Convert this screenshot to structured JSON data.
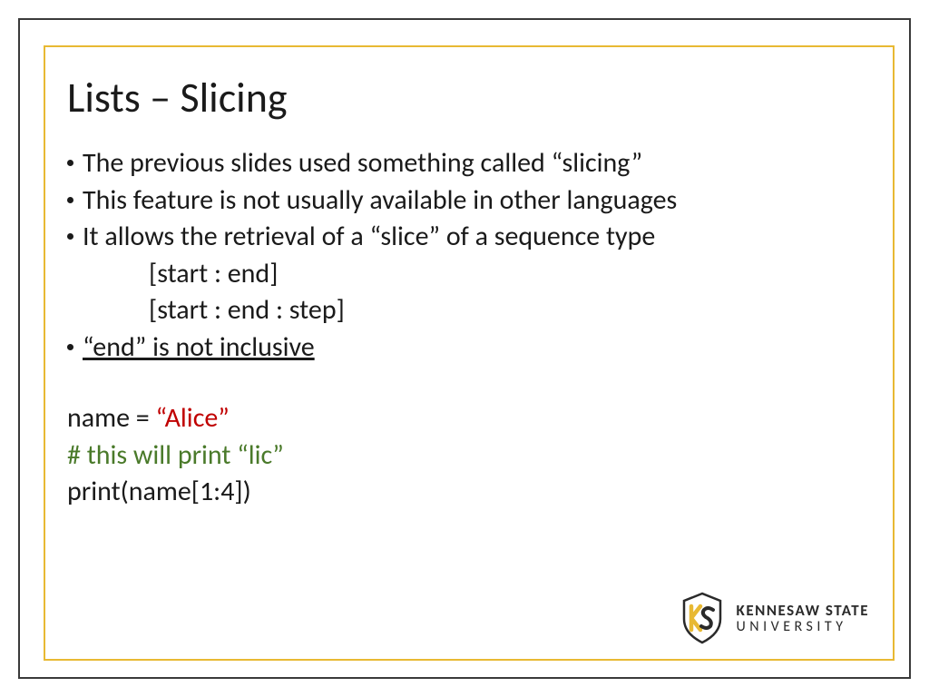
{
  "title": "Lists – Slicing",
  "bullets": [
    "The previous slides used something called “slicing”",
    "This feature is not usually available in other languages",
    "It allows the retrieval of a “slice” of a sequence type",
    "“end” is not inclusive"
  ],
  "syntax": {
    "line1": "[start : end]",
    "line2": "[start : end : step]"
  },
  "code": {
    "assign_pre": "name = ",
    "assign_val": "“Alice”",
    "comment": "# this will print “lic”",
    "print": "print(name[1:4])"
  },
  "logo": {
    "line1": "KENNESAW STATE",
    "line2": "UNIVERSITY"
  }
}
